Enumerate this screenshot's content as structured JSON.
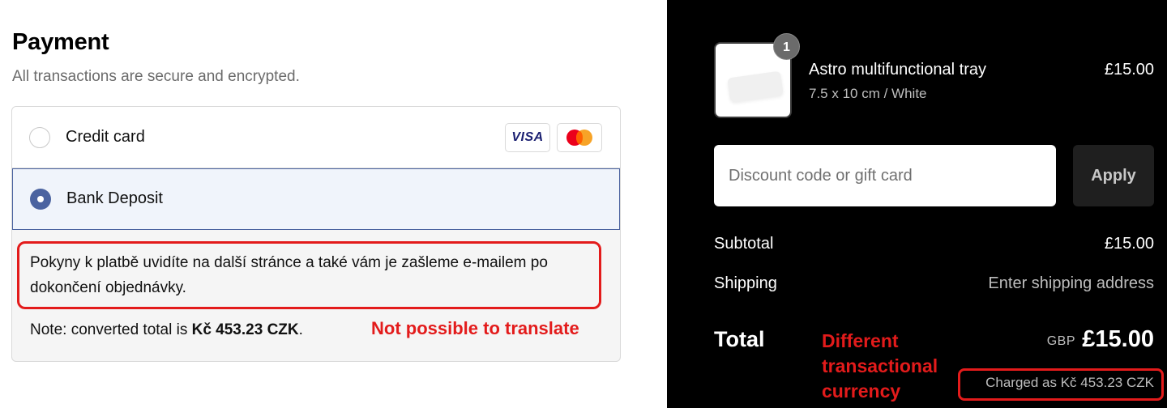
{
  "payment": {
    "title": "Payment",
    "subtitle": "All transactions are secure and encrypted.",
    "methods": [
      {
        "label": "Credit card",
        "selected": false
      },
      {
        "label": "Bank Deposit",
        "selected": true
      }
    ],
    "card_brands": {
      "visa": "VISA",
      "mastercard_icon": "mastercard-icon"
    },
    "instructions": "Pokyny k platbě uvidíte na další stránce a také vám je zašleme e-mailem po dokončení objednávky.",
    "note_prefix": "Note: converted total is ",
    "note_amount": "Kč 453.23 CZK",
    "note_suffix": ".",
    "annotation": "Not possible to translate"
  },
  "order": {
    "item": {
      "quantity": "1",
      "name": "Astro multifunctional tray",
      "variant": "7.5 x 10 cm / White",
      "price": "£15.00"
    },
    "discount": {
      "placeholder": "Discount code or gift card",
      "value": ""
    },
    "apply_label": "Apply",
    "subtotal_label": "Subtotal",
    "subtotal_value": "£15.00",
    "shipping_label": "Shipping",
    "shipping_value": "Enter shipping address",
    "total_label": "Total",
    "total_currency": "GBP",
    "total_amount": "£15.00",
    "charged_as": "Charged as Kč 453.23 CZK",
    "annotation": "Different transactional currency"
  },
  "colors": {
    "accent": "#4b63a0",
    "annotation_red": "#e31b1b",
    "summary_bg": "#000000"
  }
}
